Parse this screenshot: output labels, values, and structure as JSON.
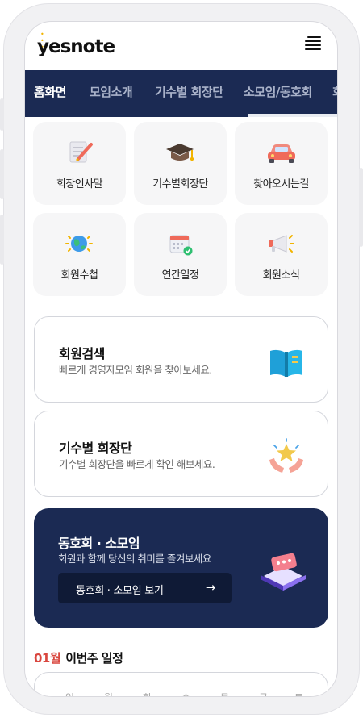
{
  "app": {
    "logo_text": "yesnote",
    "logo_dots": "• • •"
  },
  "nav": {
    "tabs": [
      {
        "label": "홈화면",
        "active": true
      },
      {
        "label": "모임소개",
        "active": false
      },
      {
        "label": "기수별 회장단",
        "active": false
      },
      {
        "label": "소모임/동호회",
        "active": false
      },
      {
        "label": "회",
        "active": false
      }
    ]
  },
  "quick_menu": [
    {
      "label": "회장인사말",
      "icon": "notepad-pencil-icon"
    },
    {
      "label": "기수별회장단",
      "icon": "graduation-cap-icon"
    },
    {
      "label": "찾아오시는길",
      "icon": "car-icon"
    },
    {
      "label": "회원수첩",
      "icon": "globe-icon"
    },
    {
      "label": "연간일정",
      "icon": "calendar-check-icon"
    },
    {
      "label": "회원소식",
      "icon": "megaphone-icon"
    }
  ],
  "cards": {
    "member_search": {
      "title": "회원검색",
      "desc": "빠르게 경영자모임 회원을 찾아보세요.",
      "icon": "open-book-icon"
    },
    "officers": {
      "title": "기수별 회장단",
      "desc": "기수별 회장단을 빠르게 확인 해보세요.",
      "icon": "hands-star-icon"
    }
  },
  "banner": {
    "title": "동호회 · 소모임",
    "desc": "회원과 함께 당신의 취미를 즐겨보세요",
    "button_label": "동호회 · 소모임 보기",
    "button_arrow": "→",
    "icon": "chat-bubble-platform-icon"
  },
  "schedule": {
    "month": "01월",
    "title": "이번주 일정",
    "weekdays": [
      "일",
      "월",
      "화",
      "수",
      "목",
      "금",
      "토"
    ]
  },
  "colors": {
    "navy": "#1b2a53",
    "accent_red": "#d9463e",
    "tile_bg": "#f6f6f7"
  }
}
